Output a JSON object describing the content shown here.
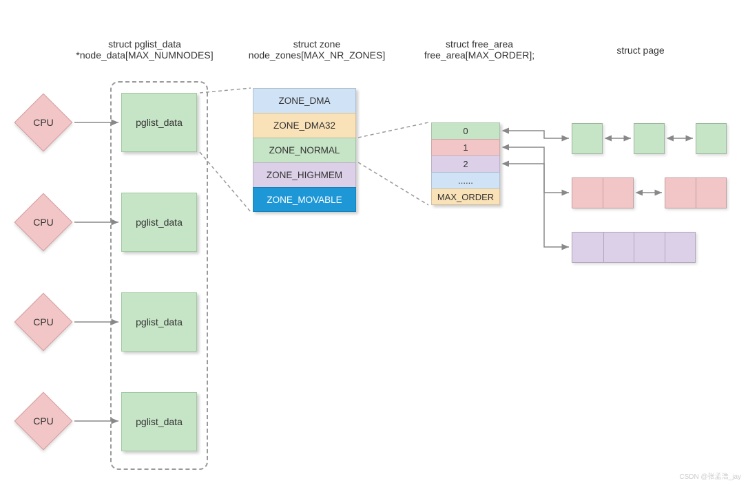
{
  "headers": {
    "pglist": {
      "l1": "struct pglist_data",
      "l2": "*node_data[MAX_NUMNODES]"
    },
    "zone": {
      "l1": "struct zone",
      "l2": "node_zones[MAX_NR_ZONES]"
    },
    "freearea": {
      "l1": "struct free_area",
      "l2": "free_area[MAX_ORDER];"
    },
    "page": {
      "l1": "struct page"
    }
  },
  "cpu_label": "CPU",
  "pglist_label": "pglist_data",
  "zones": [
    {
      "label": "ZONE_DMA",
      "bg": "#d0e2f5"
    },
    {
      "label": "ZONE_DMA32",
      "bg": "#fae2b8"
    },
    {
      "label": "ZONE_NORMAL",
      "bg": "#c6e4c6"
    },
    {
      "label": "ZONE_HIGHMEM",
      "bg": "#dcd0e8"
    },
    {
      "label": "ZONE_MOVABLE",
      "bg": "#1d97d6",
      "fg": "#ffffff"
    }
  ],
  "free_area": [
    {
      "label": "0",
      "bg": "#c6e4c6"
    },
    {
      "label": "1",
      "bg": "#f2c6c6"
    },
    {
      "label": "2",
      "bg": "#dcd0e8"
    },
    {
      "label": "......",
      "bg": "#d0e2f5"
    },
    {
      "label": "MAX_ORDER",
      "bg": "#fae2b8"
    }
  ],
  "watermark": "CSDN @张孟浩_jay"
}
